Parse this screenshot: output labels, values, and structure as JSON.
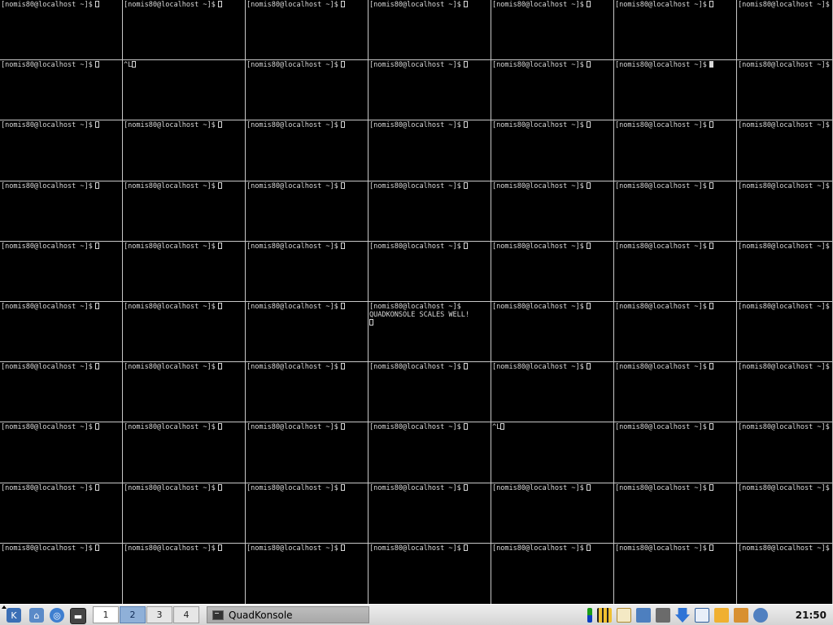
{
  "terminal": {
    "prompt": "[nomis80@localhost ~]$",
    "ctrl_l": "^L",
    "message": "QUADKONSOLE SCALES WELL!"
  },
  "taskbar": {
    "desktops": [
      "1",
      "2",
      "3",
      "4"
    ],
    "active_desktop": "2",
    "task_title": "QuadKonsole",
    "clock": "21:50",
    "launchers": [
      "kmenu-icon",
      "network-icon",
      "help-lifebuoy-icon",
      "terminal-icon"
    ],
    "tray": [
      "klipper-monitor-icon",
      "battery-meter-icon",
      "korganizer-icon",
      "printer-icon",
      "network-tool-icon",
      "download-arrow-icon",
      "calendar-icon",
      "notes-icon",
      "tool-icon",
      "network-nodes-icon"
    ]
  }
}
